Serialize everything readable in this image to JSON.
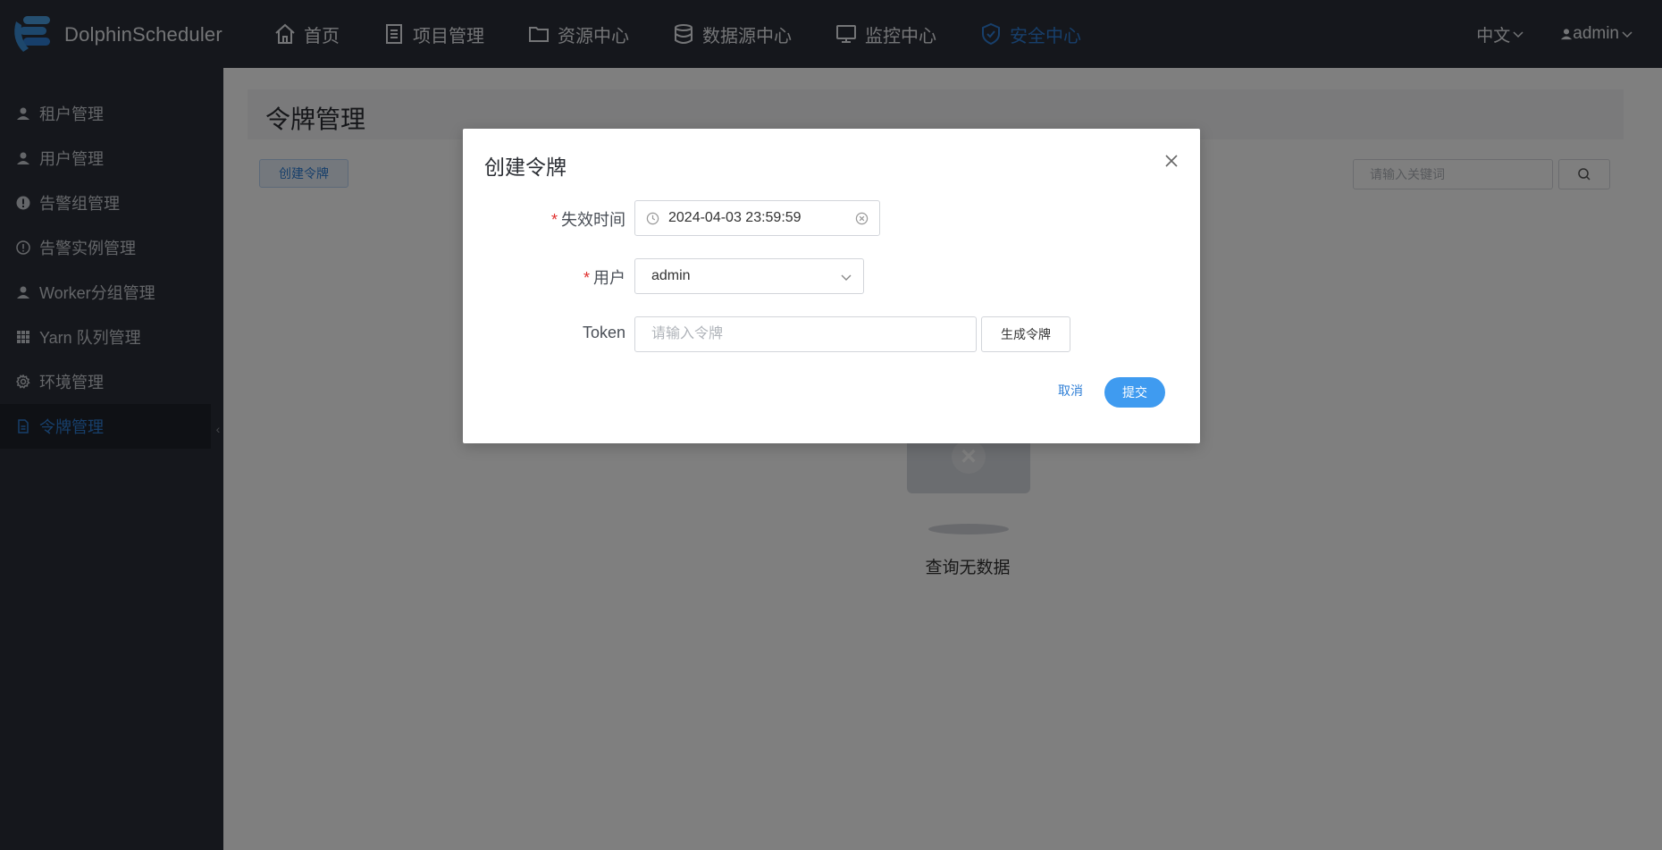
{
  "app": {
    "name": "DolphinScheduler"
  },
  "nav": {
    "items": [
      {
        "label": "首页",
        "icon": "home-icon"
      },
      {
        "label": "项目管理",
        "icon": "document-icon"
      },
      {
        "label": "资源中心",
        "icon": "folder-icon"
      },
      {
        "label": "数据源中心",
        "icon": "database-icon"
      },
      {
        "label": "监控中心",
        "icon": "monitor-icon"
      },
      {
        "label": "安全中心",
        "icon": "shield-icon",
        "active": true
      }
    ],
    "language": "中文",
    "user": "admin"
  },
  "sidebar": {
    "items": [
      {
        "label": "租户管理",
        "icon": "user-icon"
      },
      {
        "label": "用户管理",
        "icon": "user-icon"
      },
      {
        "label": "告警组管理",
        "icon": "alert-icon"
      },
      {
        "label": "告警实例管理",
        "icon": "info-circle-icon"
      },
      {
        "label": "Worker分组管理",
        "icon": "user-icon"
      },
      {
        "label": "Yarn 队列管理",
        "icon": "grid-icon"
      },
      {
        "label": "环境管理",
        "icon": "gear-icon"
      },
      {
        "label": "令牌管理",
        "icon": "file-icon",
        "active": true
      }
    ]
  },
  "page": {
    "title": "令牌管理",
    "create_button": "创建令牌",
    "search_placeholder": "请输入关键词",
    "empty_text": "查询无数据"
  },
  "modal": {
    "title": "创建令牌",
    "expire_label": "失效时间",
    "expire_value": "2024-04-03 23:59:59",
    "user_label": "用户",
    "user_value": "admin",
    "token_label": "Token",
    "token_placeholder": "请输入令牌",
    "generate_button": "生成令牌",
    "cancel_button": "取消",
    "submit_button": "提交",
    "required_mark": "*"
  },
  "colors": {
    "nav_bg": "#2b2f38",
    "accent": "#2f7fd6",
    "primary_button": "#3f9bf0",
    "required": "#e0302e"
  }
}
